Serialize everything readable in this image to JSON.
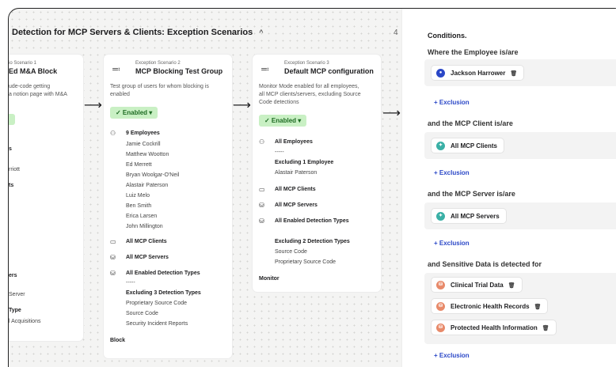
{
  "header": {
    "title": "Detection for MCP Servers & Clients: Exception Scenarios",
    "chevron": "^",
    "count": "4"
  },
  "card1": {
    "scenario_label": "io Scenario 1",
    "title": "Ed M&A Block",
    "desc_lines": [
      "ude-code getting",
      "a notion page with M&A"
    ],
    "rows": [
      "s",
      "rriott",
      "ts",
      "rs",
      "ers",
      "Server",
      "Type",
      "l Acquisitions"
    ]
  },
  "card2": {
    "scenario_label": "Exception Scenario 2",
    "title": "MCP Blocking Test Group",
    "desc_lines": [
      "Test group of users for whom blocking is",
      "enabled"
    ],
    "status": "✓ Enabled ▾",
    "employees_head": "9 Employees",
    "employees": [
      "Jamie Cockrill",
      "Matthew Wootton",
      "Ed Merrett",
      "Bryan Woolgar-O'Neil",
      "Alastair Paterson",
      "Luiz Melo",
      "Ben Smith",
      "Erica Larsen",
      "John Millington"
    ],
    "clients": "All MCP Clients",
    "servers": "All MCP Servers",
    "detections": "All Enabled Detection Types",
    "dashes": "-----",
    "excluding": "Excluding 3 Detection Types",
    "excluded_types": [
      "Proprietary Source Code",
      "Source Code",
      "Security Incident Reports"
    ],
    "action": "Block"
  },
  "card3": {
    "scenario_label": "Exception Scenario 3",
    "title": "Default MCP configuration",
    "desc_lines": [
      "Monitor Mode enabled for all employees,",
      "all MCP clients/servers, excluding Source",
      "Code detections"
    ],
    "status": "✓ Enabled ▾",
    "employees_head": "All Employees",
    "dashes": "-----",
    "excluding_emp": "Excluding 1 Employee",
    "excluded_emp": "Alastair Paterson",
    "clients": "All MCP Clients",
    "servers": "All MCP Servers",
    "detections": "All Enabled Detection Types",
    "excluding": "Excluding 2 Detection Types",
    "excluded_types": [
      "Source Code",
      "Proprietary Source Code"
    ],
    "action": "Monitor"
  },
  "panel": {
    "title": "Conditions.",
    "employee_label": "Where the Employee is/are",
    "employee_chip": "Jackson Harrower",
    "client_label": "and the MCP Client is/are",
    "client_chip": "All MCP Clients",
    "server_label": "and the MCP Server is/are",
    "server_chip": "All MCP Servers",
    "data_label": "and Sensitive Data is detected for",
    "data_chips": [
      "Clinical Trial Data",
      "Electronic Health Records",
      "Protected Health Information"
    ],
    "exclusion": "+ Exclusion"
  },
  "colors": {
    "enabled_bg": "#c9f0c4",
    "enabled_fg": "#1e6b23",
    "link": "#2a47c7"
  }
}
